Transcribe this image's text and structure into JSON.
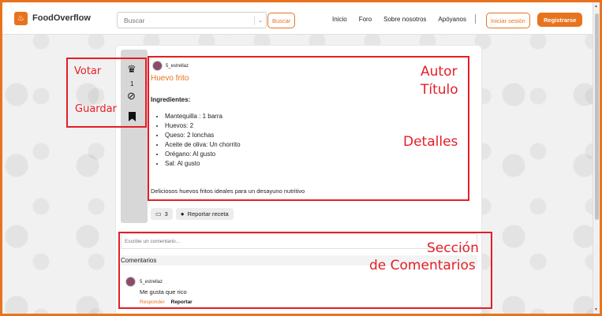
{
  "brand": {
    "name": "FoodOverflow"
  },
  "search": {
    "placeholder": "Buscar",
    "button": "Buscar"
  },
  "nav": {
    "items": [
      "Inicio",
      "Foro",
      "Sobre nosotros",
      "Apóyanos"
    ]
  },
  "auth": {
    "login": "Iniciar sesión",
    "register": "Registrarse"
  },
  "colors": {
    "accent": "#e8731f",
    "annotation": "#e41e26"
  },
  "voting": {
    "count": "1",
    "icons": [
      "chef-hat-icon",
      "chef-hat-slashed-icon",
      "bookmark-icon"
    ]
  },
  "post": {
    "author": "5_estrellaz",
    "title": "Huevo frito",
    "ingredients_heading": "Ingredientes:",
    "ingredients": [
      "Mantequilla : 1 barra",
      "Huevos: 2",
      "Queso: 2 lonchas",
      "Aceite de oliva: Un chorrito",
      "Orégano: Al gusto",
      "Sal: Al gusto"
    ],
    "description": "Deliciosos huevos fritos ideales para un desayuno nutritivo",
    "comment_count": "3",
    "report_label": "Reportar receta"
  },
  "comments": {
    "placeholder": "Escribe un comentario...",
    "heading": "Comentarios",
    "items": [
      {
        "author": "5_estrellaz",
        "text": "Me gusta que rico",
        "reply": "Responder",
        "report": "Reportar"
      }
    ]
  },
  "annotations": {
    "votar": "Votar",
    "guardar": "Guardar",
    "autor": "Autor",
    "titulo": "Título",
    "detalles": "Detalles",
    "seccion_line1": "Sección",
    "seccion_line2": "de Comentarios"
  }
}
